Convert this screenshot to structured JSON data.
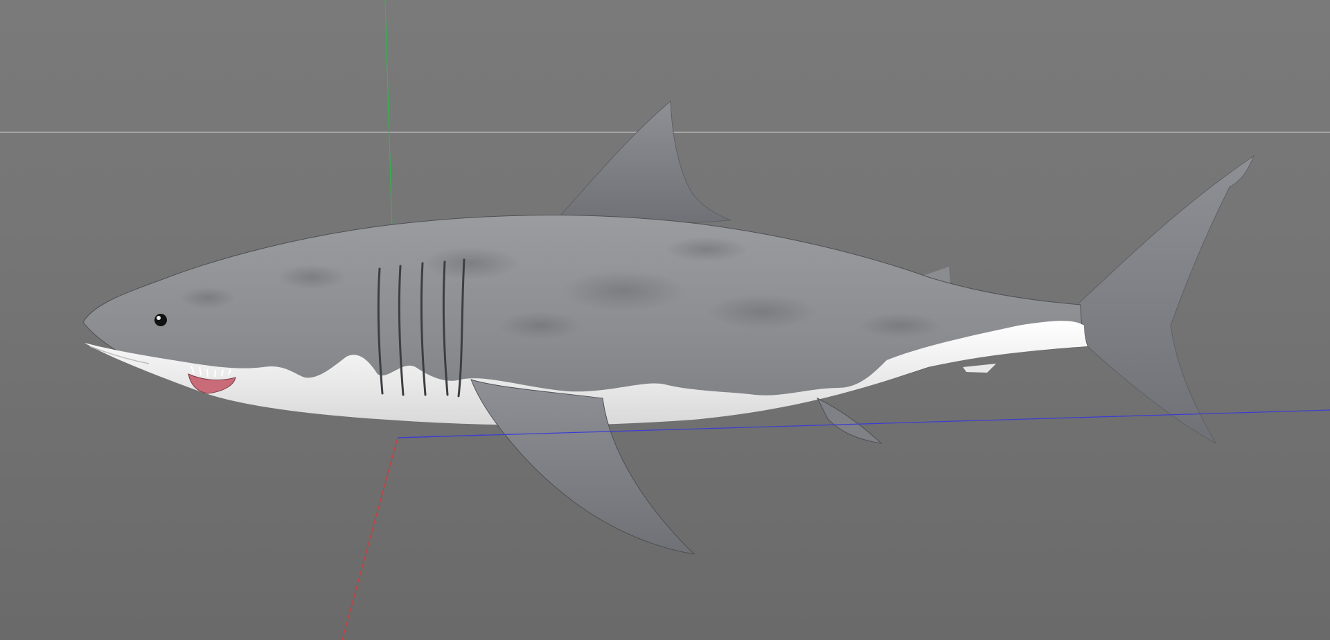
{
  "viewport": {
    "background": "#757575",
    "horizon_color": "#b4b4b4",
    "axis_x_color": "#3b3bd6",
    "axis_y_color": "#2fb84a",
    "axis_z_color": "#d23a3a"
  },
  "model": {
    "body_color": "#8f9196",
    "belly_color": "#f2f2f2",
    "mouth_color": "#c96b78"
  }
}
